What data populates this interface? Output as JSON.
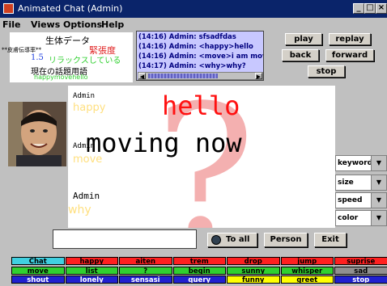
{
  "window": {
    "title": "Animated Chat (Admin)"
  },
  "menu": [
    "File",
    "Views",
    "Options",
    "Help"
  ],
  "vital": {
    "heading": "生体データ",
    "metric_label": "**皮膚伝導率**",
    "metric_value": "1.5",
    "tension": "緊張度",
    "relax": "リラックスしている",
    "topic_heading": "現在の話題用語",
    "topic_words": "happymovehello"
  },
  "chatlog": [
    "(14:16) Admin: sfsadfdas",
    "(14:16) Admin: <happy>hello",
    "(14:16) Admin: <move>i am moving",
    "(14:17) Admin: <why>why?"
  ],
  "playback": {
    "play": "play",
    "replay": "replay",
    "back": "back",
    "forward": "forward",
    "stop": "stop"
  },
  "stage": {
    "big_char": "?",
    "msg1_user": "Admin",
    "msg1_tag": "happy",
    "msg1_text": "hello",
    "msg2_user": "Admin",
    "msg2_tag": "move",
    "msg2_text": "moving now",
    "msg3_user": "Admin",
    "msg3_tag": "why"
  },
  "controls": [
    "keyword",
    "size",
    "speed",
    "color"
  ],
  "actions": {
    "to_all": "To all",
    "person": "Person",
    "exit": "Exit"
  },
  "emotion_grid": [
    [
      {
        "t": "Chat",
        "bg": "#40d0e0",
        "fg": "#000"
      },
      {
        "t": "happy",
        "bg": "#ff2020",
        "fg": "#000"
      },
      {
        "t": "aiten",
        "bg": "#ff2020",
        "fg": "#000"
      },
      {
        "t": "trem",
        "bg": "#ff2020",
        "fg": "#000"
      },
      {
        "t": "drop",
        "bg": "#ff2020",
        "fg": "#000"
      },
      {
        "t": "jump",
        "bg": "#ff2020",
        "fg": "#000"
      },
      {
        "t": "suprise",
        "bg": "#ff2020",
        "fg": "#000"
      }
    ],
    [
      {
        "t": "move",
        "bg": "#30d030",
        "fg": "#000"
      },
      {
        "t": "list",
        "bg": "#30d030",
        "fg": "#000"
      },
      {
        "t": "?",
        "bg": "#30d030",
        "fg": "#000"
      },
      {
        "t": "begin",
        "bg": "#30d030",
        "fg": "#000"
      },
      {
        "t": "sunny",
        "bg": "#30d030",
        "fg": "#000"
      },
      {
        "t": "whisper",
        "bg": "#30d030",
        "fg": "#000"
      },
      {
        "t": "sad",
        "bg": "#909090",
        "fg": "#000"
      }
    ],
    [
      {
        "t": "shout",
        "bg": "#2020d0",
        "fg": "#fff"
      },
      {
        "t": "lonely",
        "bg": "#2020d0",
        "fg": "#fff"
      },
      {
        "t": "sensasi",
        "bg": "#2020d0",
        "fg": "#fff"
      },
      {
        "t": "query",
        "bg": "#2020d0",
        "fg": "#fff"
      },
      {
        "t": "funny",
        "bg": "#ffff00",
        "fg": "#000"
      },
      {
        "t": "greet",
        "bg": "#ffff00",
        "fg": "#000"
      },
      {
        "t": "stop",
        "bg": "#2020d0",
        "fg": "#fff"
      }
    ]
  ]
}
